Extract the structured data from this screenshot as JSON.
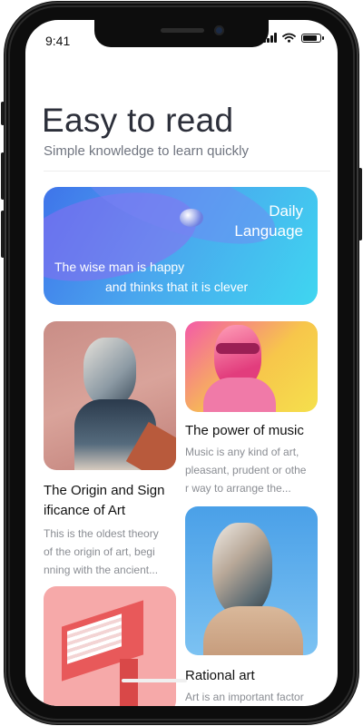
{
  "status": {
    "time": "9:41"
  },
  "header": {
    "title": "Easy to read",
    "subtitle": "Simple knowledge to learn quickly"
  },
  "banner": {
    "title_line1": "Daily",
    "title_line2": "Language",
    "quote_line1": "The wise man is happy",
    "quote_line2": "and thinks that it is clever"
  },
  "cards": {
    "origin": {
      "title_line1": "The Origin and Sign",
      "title_line2": "ificance of Art",
      "desc_line1": "This is the oldest theory",
      "desc_line2": "of the origin of art, begi",
      "desc_line3": "nning with the ancient..."
    },
    "music": {
      "title": "The power of music",
      "desc_line1": "Music is any kind of art,",
      "desc_line2": "pleasant, prudent or othe",
      "desc_line3": "r way to arrange the..."
    },
    "rational": {
      "title": "Rational art",
      "desc_line1": "Art is an important factor"
    }
  },
  "colors": {
    "accent_banner": "#4aa6ee",
    "title_text": "#2c2f3a",
    "subtitle_text": "#707580"
  }
}
